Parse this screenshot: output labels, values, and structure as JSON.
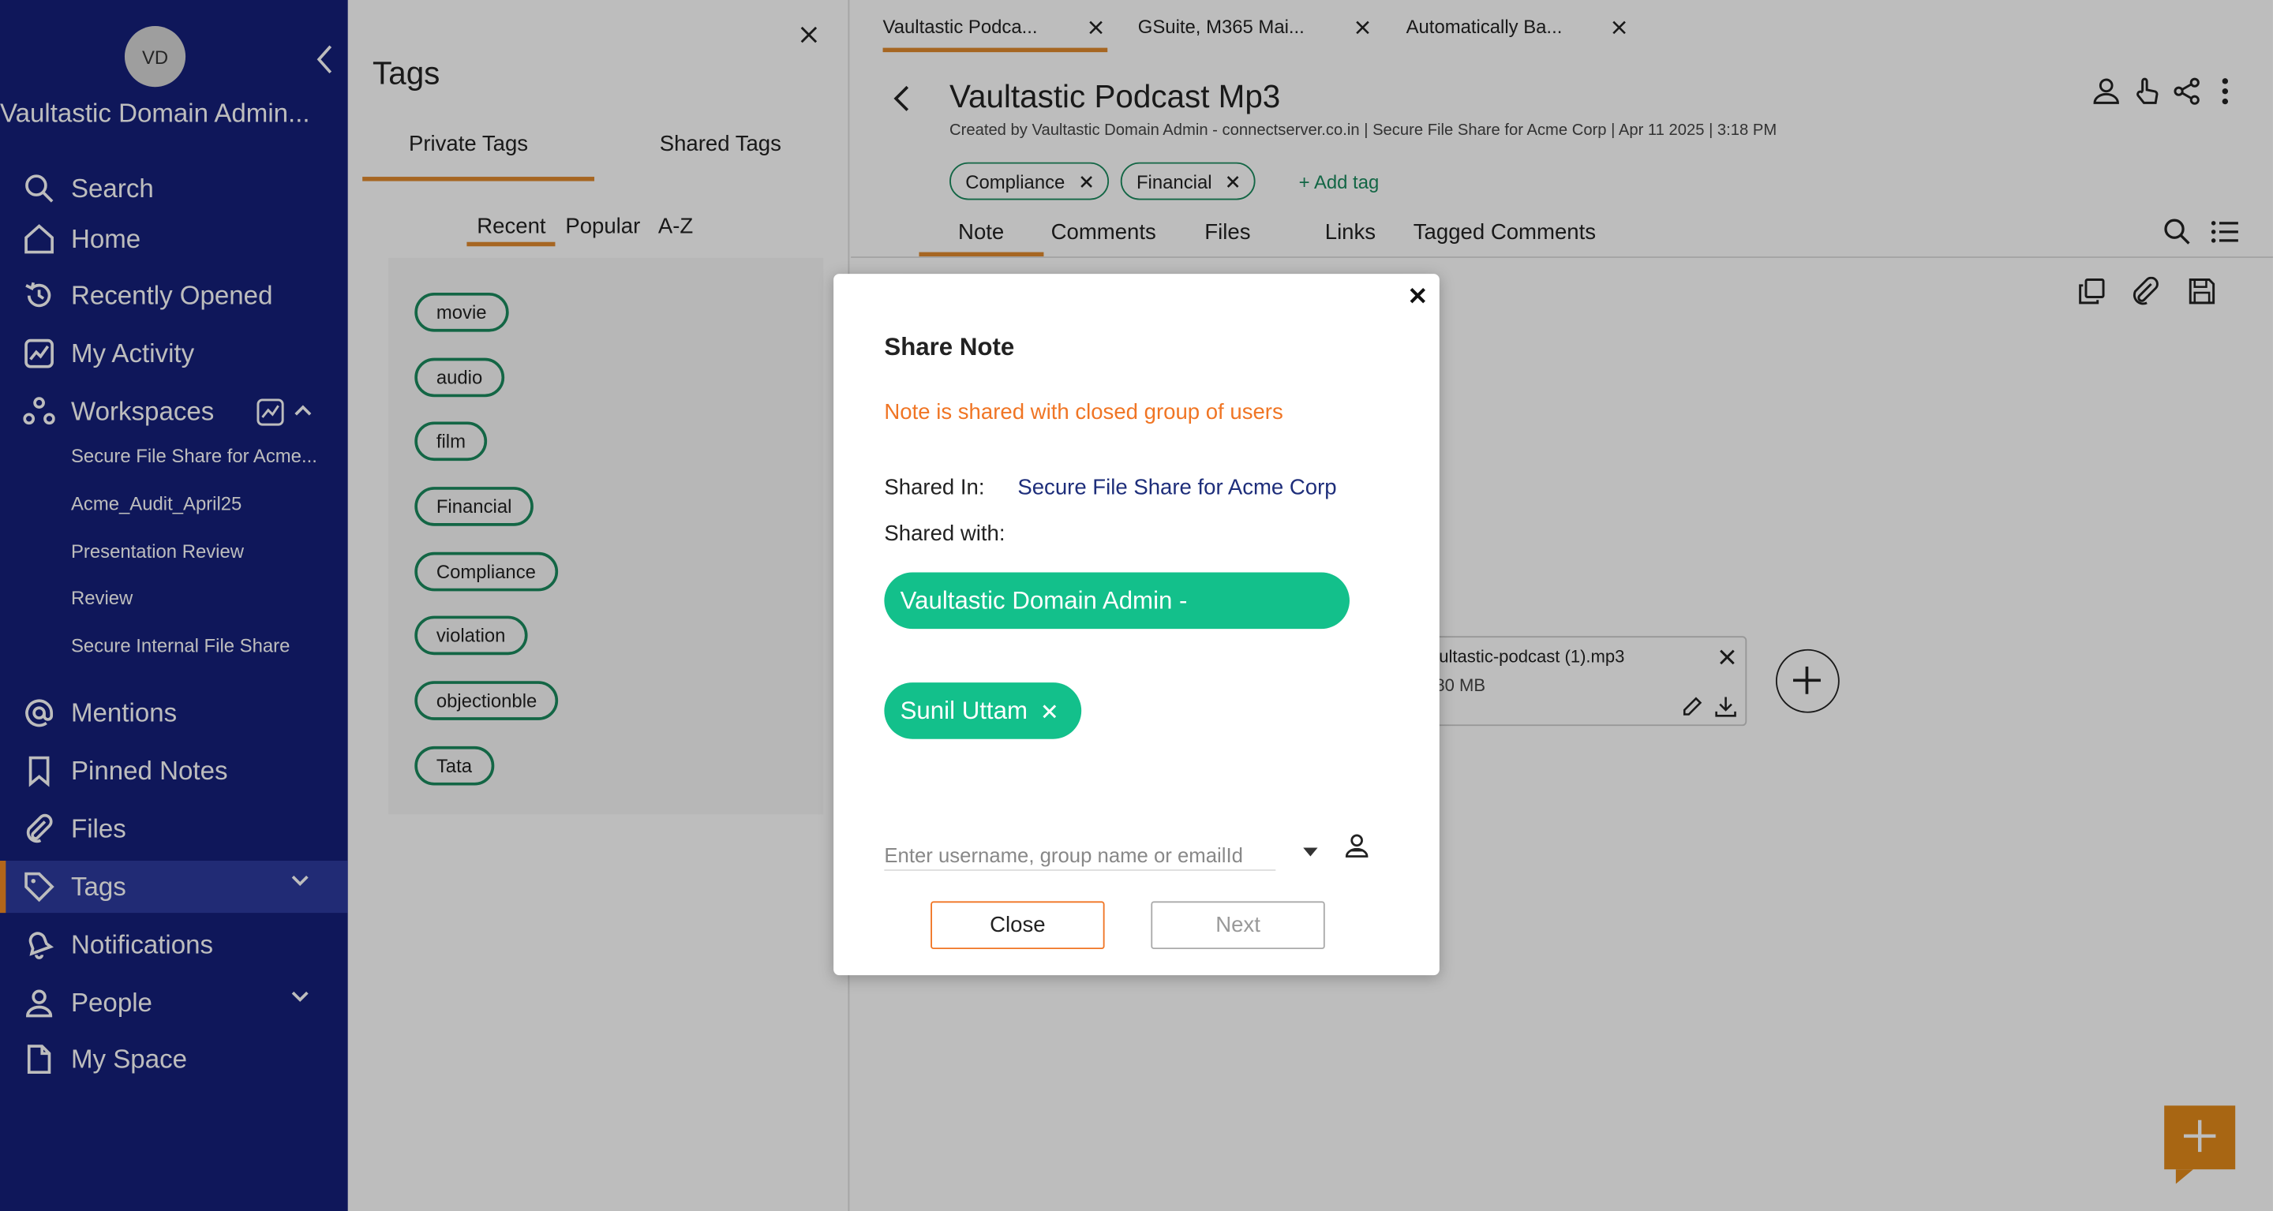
{
  "sidebar": {
    "avatar_initials": "VD",
    "org_name": "Vaultastic Domain Admin...",
    "nav": {
      "search": "Search",
      "home": "Home",
      "recently_opened": "Recently Opened",
      "my_activity": "My Activity",
      "workspaces": "Workspaces",
      "mentions": "Mentions",
      "pinned_notes": "Pinned Notes",
      "files": "Files",
      "tags": "Tags",
      "notifications": "Notifications",
      "people": "People",
      "my_space": "My Space"
    },
    "workspaces": [
      "Secure File Share for Acme...",
      "Acme_Audit_April25",
      "Presentation Review",
      "Review",
      "Secure Internal File Share"
    ],
    "active_item": "Tags"
  },
  "tags_panel": {
    "title": "Tags",
    "tabs": [
      "Private Tags",
      "Shared Tags"
    ],
    "active_tab": "Private Tags",
    "sort_tabs": [
      "Recent",
      "Popular",
      "A-Z"
    ],
    "active_sort": "Recent",
    "tags": [
      "movie",
      "audio",
      "film",
      "Financial",
      "Compliance",
      "violation",
      "objectionble",
      "Tata"
    ]
  },
  "main": {
    "doc_tabs": [
      "Vaultastic Podca...",
      "GSuite, M365 Mai...",
      "Automatically Ba..."
    ],
    "active_doc_tab": "Vaultastic Podca...",
    "title": "Vaultastic Podcast Mp3",
    "meta": "Created by  Vaultastic Domain Admin - connectserver.co.in  |  Secure File Share for Acme Corp  | Apr 11 2025 | 3:18 PM",
    "tags": [
      "Compliance",
      "Financial"
    ],
    "add_tag_label": "+ Add tag",
    "note_tabs": [
      "Note",
      "Comments",
      "Files",
      "Links",
      "Tagged Comments"
    ],
    "active_note_tab": "Note",
    "attachment": {
      "name": "vaultastic-podcast (1).mp3",
      "size": "7.80 MB"
    }
  },
  "modal": {
    "title": "Share Note",
    "notice": "Note is shared with closed group of users",
    "shared_in_label": "Shared In:",
    "shared_in_value": "Secure File Share for Acme Corp",
    "shared_with_label": "Shared with:",
    "shared_with": [
      "Vaultastic Domain Admin -",
      "Sunil Uttam"
    ],
    "input_placeholder": "Enter username, group name or emailId",
    "close_label": "Close",
    "next_label": "Next"
  },
  "colors": {
    "sidebar_bg": "#151f7a",
    "accent_orange": "#e08a2e",
    "tag_green": "#1a8a5e",
    "chip_green": "#13c08b",
    "notice_orange": "#f07524"
  }
}
